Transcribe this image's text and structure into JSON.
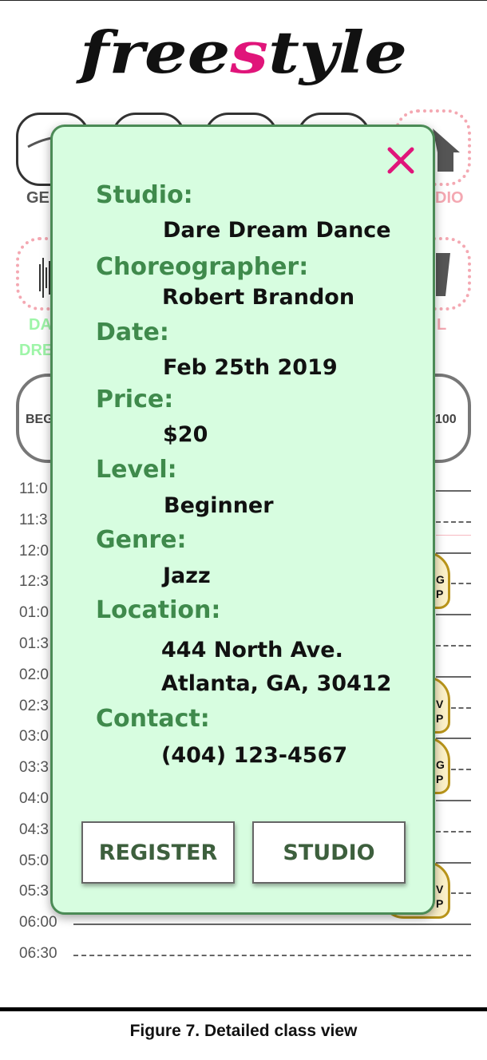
{
  "app": {
    "logo_text": "freestyle",
    "colors": {
      "accent": "#e0157a",
      "green": "#3f8a4c",
      "modal_bg": "#d7fde0"
    }
  },
  "filters": {
    "genre_label": "GE",
    "studio_label": "DIO",
    "studio_icon": "house-icon",
    "dance_label_1": "DA",
    "dance_label_2": "DRE",
    "all_label": "L"
  },
  "level_bar": {
    "left_label": "BEG",
    "right_label": "100"
  },
  "timeline": {
    "times": [
      "11:0",
      "11:3",
      "12:0",
      "12:3",
      "01:0",
      "01:3",
      "02:0",
      "02:3",
      "03:0",
      "03:3",
      "04:0",
      "04:3",
      "05:0",
      "05:3",
      "06:00",
      "06:30"
    ],
    "cards": [
      {
        "line1": "G",
        "line2": "P"
      },
      {
        "line1": "V",
        "line2": "P"
      },
      {
        "line1": "G",
        "line2": "P"
      },
      {
        "line1": "V",
        "line2": "P"
      }
    ]
  },
  "modal": {
    "close_icon": "close-icon",
    "studio_label": "Studio:",
    "studio_value": "Dare Dream Dance",
    "choreographer_label": "Choreographer:",
    "choreographer_value": "Robert Brandon",
    "date_label": "Date:",
    "date_value": "Feb 25th 2019",
    "price_label": "Price:",
    "price_value": "$20",
    "level_label": "Level:",
    "level_value": "Beginner",
    "genre_label": "Genre:",
    "genre_value": "Jazz",
    "location_label": "Location:",
    "location_line1": "444 North Ave.",
    "location_line2": "Atlanta, GA, 30412",
    "contact_label": "Contact:",
    "contact_value": "(404) 123-4567",
    "register_button": "REGISTER",
    "studio_button": "STUDIO"
  },
  "caption": "Figure 7. Detailed class view"
}
